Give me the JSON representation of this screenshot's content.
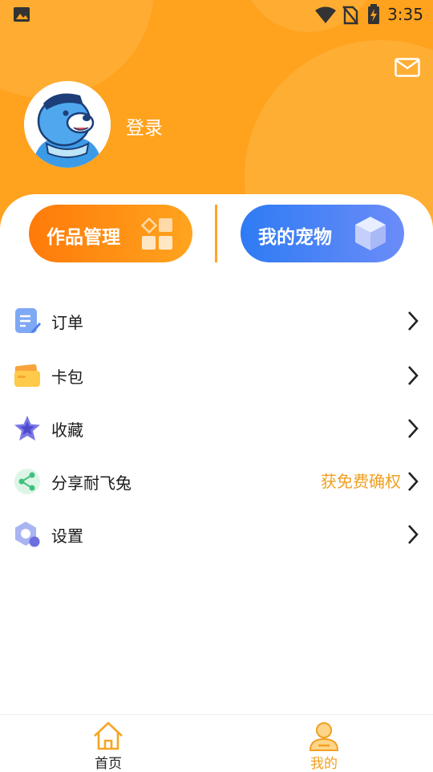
{
  "status_bar": {
    "time": "3:35",
    "icons": [
      "image-icon",
      "wifi-icon",
      "no-sim-icon",
      "battery-charging-icon"
    ]
  },
  "header": {
    "mail_icon": "mail-icon",
    "login_label": "登录",
    "colors": {
      "background": "#FFA21E"
    }
  },
  "quick_actions": {
    "works_label": "作品管理",
    "pet_label": "我的宠物"
  },
  "menu": [
    {
      "label": "订单",
      "icon": "order-list-icon",
      "extra": ""
    },
    {
      "label": "卡包",
      "icon": "card-wallet-icon",
      "extra": ""
    },
    {
      "label": "收藏",
      "icon": "star-icon",
      "extra": ""
    },
    {
      "label": "分享耐飞兔",
      "icon": "share-icon",
      "extra": "获免费确权"
    },
    {
      "label": "设置",
      "icon": "settings-icon",
      "extra": ""
    }
  ],
  "tabbar": {
    "home_label": "首页",
    "mine_label": "我的",
    "active_color": "#F0A020"
  }
}
